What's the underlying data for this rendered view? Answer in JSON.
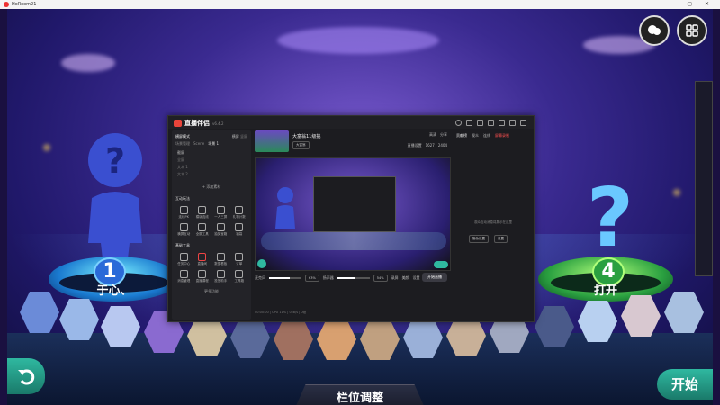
{
  "titlebar": {
    "title": "HoRoom21"
  },
  "game": {
    "players": [
      {
        "number": "1",
        "name": "于心、"
      },
      {
        "number": "4",
        "name": "打开"
      }
    ],
    "position_button": "栏位调整",
    "start_button": "开始"
  },
  "window": {
    "app_name": "直播伴侣",
    "app_version": "v6.4.2",
    "left": {
      "mode_label": "横屏模式",
      "tabs": [
        "横屏",
        "竖屏"
      ],
      "scene_labels": [
        "场景管理",
        "Scene",
        "场景 1"
      ],
      "sources": [
        "截屏",
        "全屏",
        "文本 1",
        "文本 2"
      ],
      "add_source": "添加素材",
      "interactive_title": "互动玩法",
      "interactive_tools": [
        "连线PK",
        "模版连线",
        "一人三屏",
        "礼物计数"
      ],
      "interactive_tools2": [
        "横屏互动",
        "全屏工具",
        "抽奖宝箱",
        "福袋"
      ],
      "basic_title": "基础工具",
      "basic_tools": [
        "任务中心",
        "直播间",
        "数据看板",
        "订单"
      ],
      "basic_tools2": [
        "消息管理",
        "直播课程",
        "投放助手",
        "工具箱"
      ],
      "more": "更多功能"
    },
    "mid": {
      "stream_title": "大富翁11级挑",
      "tag": "大富翁",
      "hq_label": "高清",
      "share_label": "分享",
      "stats": [
        "1627",
        "2404"
      ],
      "speed_label": "直播设置",
      "mic_label": "麦克风",
      "mic_pct": "63%",
      "spk_label": "扬声器",
      "spk_pct": "54%",
      "tools": [
        "录屏",
        "美颜",
        "设置"
      ],
      "start_live": "开始直播",
      "status": "00:00:00 | CPU 11% | 0kb/s | 0帧"
    },
    "right": {
      "tabs": [
        "贡献榜",
        "观众",
        "连线"
      ],
      "record_label": "屏幕录制",
      "empty_text": "观众互动消息将展示在这里",
      "btn1": "隐私设置",
      "btn2": "设置"
    }
  }
}
